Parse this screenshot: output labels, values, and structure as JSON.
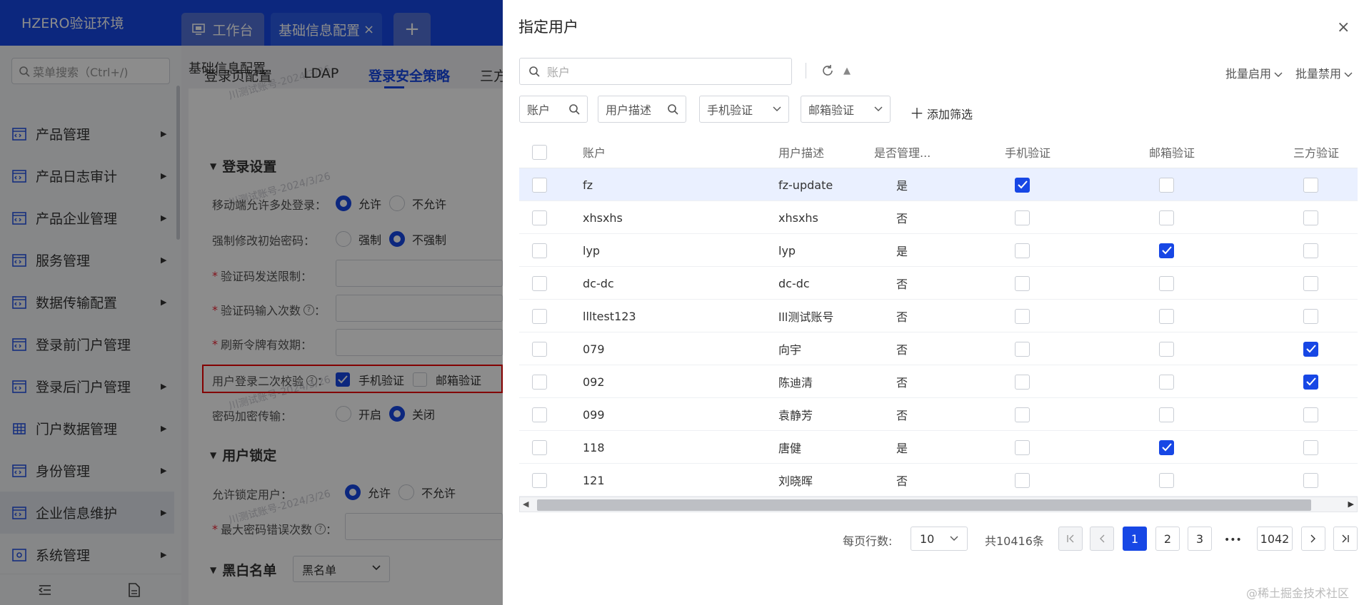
{
  "app": {
    "brand": "HZERO验证环境"
  },
  "tabs": [
    {
      "label": "工作台",
      "icon": "monitor-icon"
    },
    {
      "label": "基础信息配置",
      "close": "×"
    },
    {
      "label": "+"
    }
  ],
  "sidebar": {
    "search_placeholder": "菜单搜索（Ctrl+/)",
    "items": [
      {
        "label": "产品管理",
        "icon": "menu-icon"
      },
      {
        "label": "产品日志审计",
        "icon": "menu-icon"
      },
      {
        "label": "产品企业管理",
        "icon": "menu-icon"
      },
      {
        "label": "服务管理",
        "icon": "menu-icon"
      },
      {
        "label": "数据传输配置",
        "icon": "menu-icon"
      },
      {
        "label": "登录前门户管理",
        "icon": "menu-icon"
      },
      {
        "label": "登录后门户管理",
        "icon": "menu-icon"
      },
      {
        "label": "门户数据管理",
        "icon": "grid-icon"
      },
      {
        "label": "身份管理",
        "icon": "menu-icon"
      },
      {
        "label": "企业信息维护",
        "icon": "menu-icon"
      },
      {
        "label": "系统管理",
        "icon": "gear-menu-icon"
      }
    ]
  },
  "main": {
    "page_title": "基础信息配置",
    "sub_tabs": [
      "登录页配置",
      "LDAP",
      "登录安全策略",
      "三方"
    ],
    "watermark": "川测试账号-2024/3/26",
    "login_settings": {
      "title": "登录设置",
      "multi_login": {
        "label": "移动端允许多处登录：",
        "options": [
          "允许",
          "不允许"
        ]
      },
      "force_change": {
        "label": "强制修改初始密码：",
        "options": [
          "强制",
          "不强制"
        ]
      },
      "code_limit": {
        "label": "验证码发送限制："
      },
      "code_attempts": {
        "label": "验证码输入次数",
        "colon": "："
      },
      "token_ttl": {
        "label": "刷新令牌有效期："
      },
      "second_check": {
        "label": "用户登录二次校验",
        "colon": "：",
        "options": [
          "手机验证",
          "邮箱验证"
        ]
      },
      "pwd_encrypt": {
        "label": "密码加密传输：",
        "options": [
          "开启",
          "关闭"
        ]
      }
    },
    "user_lock": {
      "title": "用户锁定",
      "allow_lock": {
        "label": "允许锁定用户：",
        "options": [
          "允许",
          "不允许"
        ]
      },
      "max_errors": {
        "label": "最大密码错误次数",
        "colon": "："
      }
    },
    "blackwhite": {
      "title": "黑白名单",
      "value": "黑名单"
    }
  },
  "drawer": {
    "title": "指定用户",
    "close": "×",
    "search_placeholder": "账户",
    "batch_enable": "批量启用",
    "batch_disable": "批量禁用",
    "filters": [
      "账户",
      "用户描述",
      "手机验证",
      "邮箱验证"
    ],
    "add_filter": "添加筛选",
    "columns": [
      "账户",
      "用户描述",
      "是否管理...",
      "手机验证",
      "邮箱验证",
      "三方验证"
    ],
    "rows": [
      {
        "account": "fz",
        "desc": "fz-update",
        "admin": "是",
        "phone": true,
        "email": false,
        "third": false
      },
      {
        "account": "xhsxhs",
        "desc": "xhsxhs",
        "admin": "否",
        "phone": false,
        "email": false,
        "third": false
      },
      {
        "account": "lyp",
        "desc": "lyp",
        "admin": "是",
        "phone": false,
        "email": true,
        "third": false
      },
      {
        "account": "dc-dc",
        "desc": "dc-dc",
        "admin": "否",
        "phone": false,
        "email": false,
        "third": false
      },
      {
        "account": "llltest123",
        "desc": "lll测试账号",
        "admin": "否",
        "phone": false,
        "email": false,
        "third": false
      },
      {
        "account": "079",
        "desc": "向宇",
        "admin": "否",
        "phone": false,
        "email": false,
        "third": true
      },
      {
        "account": "092",
        "desc": "陈迪清",
        "admin": "否",
        "phone": false,
        "email": false,
        "third": true
      },
      {
        "account": "099",
        "desc": "袁静芳",
        "admin": "否",
        "phone": false,
        "email": false,
        "third": false
      },
      {
        "account": "118",
        "desc": "唐健",
        "admin": "是",
        "phone": false,
        "email": true,
        "third": false
      },
      {
        "account": "121",
        "desc": "刘晓晖",
        "admin": "否",
        "phone": false,
        "email": false,
        "third": false
      }
    ],
    "pagination": {
      "rows_per_page_label": "每页行数:",
      "page_size": "10",
      "total": "共10416条",
      "pages": [
        "1",
        "2",
        "3"
      ],
      "ellipsis": "•••",
      "last_page": "1042"
    }
  },
  "credit": "@稀土掘金技术社区"
}
